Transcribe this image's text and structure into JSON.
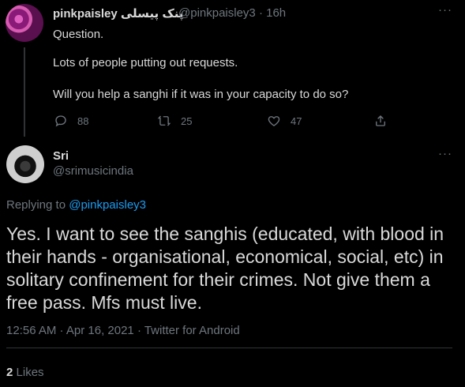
{
  "parent_tweet": {
    "display_name": "pinkpaisley پنک پیسلی",
    "handle": "@pinkpaisley3",
    "separator": "·",
    "time": "16h",
    "more": "···",
    "lines": [
      "Question.",
      "Lots of people putting out requests.",
      "Will you help a sanghi if it was in your capacity to do so?"
    ],
    "replies": "88",
    "retweets": "25",
    "likes": "47",
    "icons": [
      "reply-icon",
      "retweet-icon",
      "like-icon",
      "share-icon"
    ]
  },
  "reply_tweet": {
    "display_name": "Sri",
    "handle": "@srimusicindia",
    "more": "···",
    "replying_label": "Replying to",
    "replying_handle": "@pinkpaisley3",
    "body": "Yes. I want to see the sanghis (educated, with blood in their hands - organisational, economical, social, etc) in solitary confinement for their crimes. Not give them a free pass. Mfs must live.",
    "timestamp": "12:56 AM · Apr 16, 2021 · Twitter for Android",
    "likes_count": "2",
    "likes_label": "Likes"
  },
  "colors": {
    "background": "#000000",
    "text": "#d9d9d9",
    "muted": "#6e767d",
    "link": "#1d9bf0",
    "divider": "#2f3336"
  }
}
